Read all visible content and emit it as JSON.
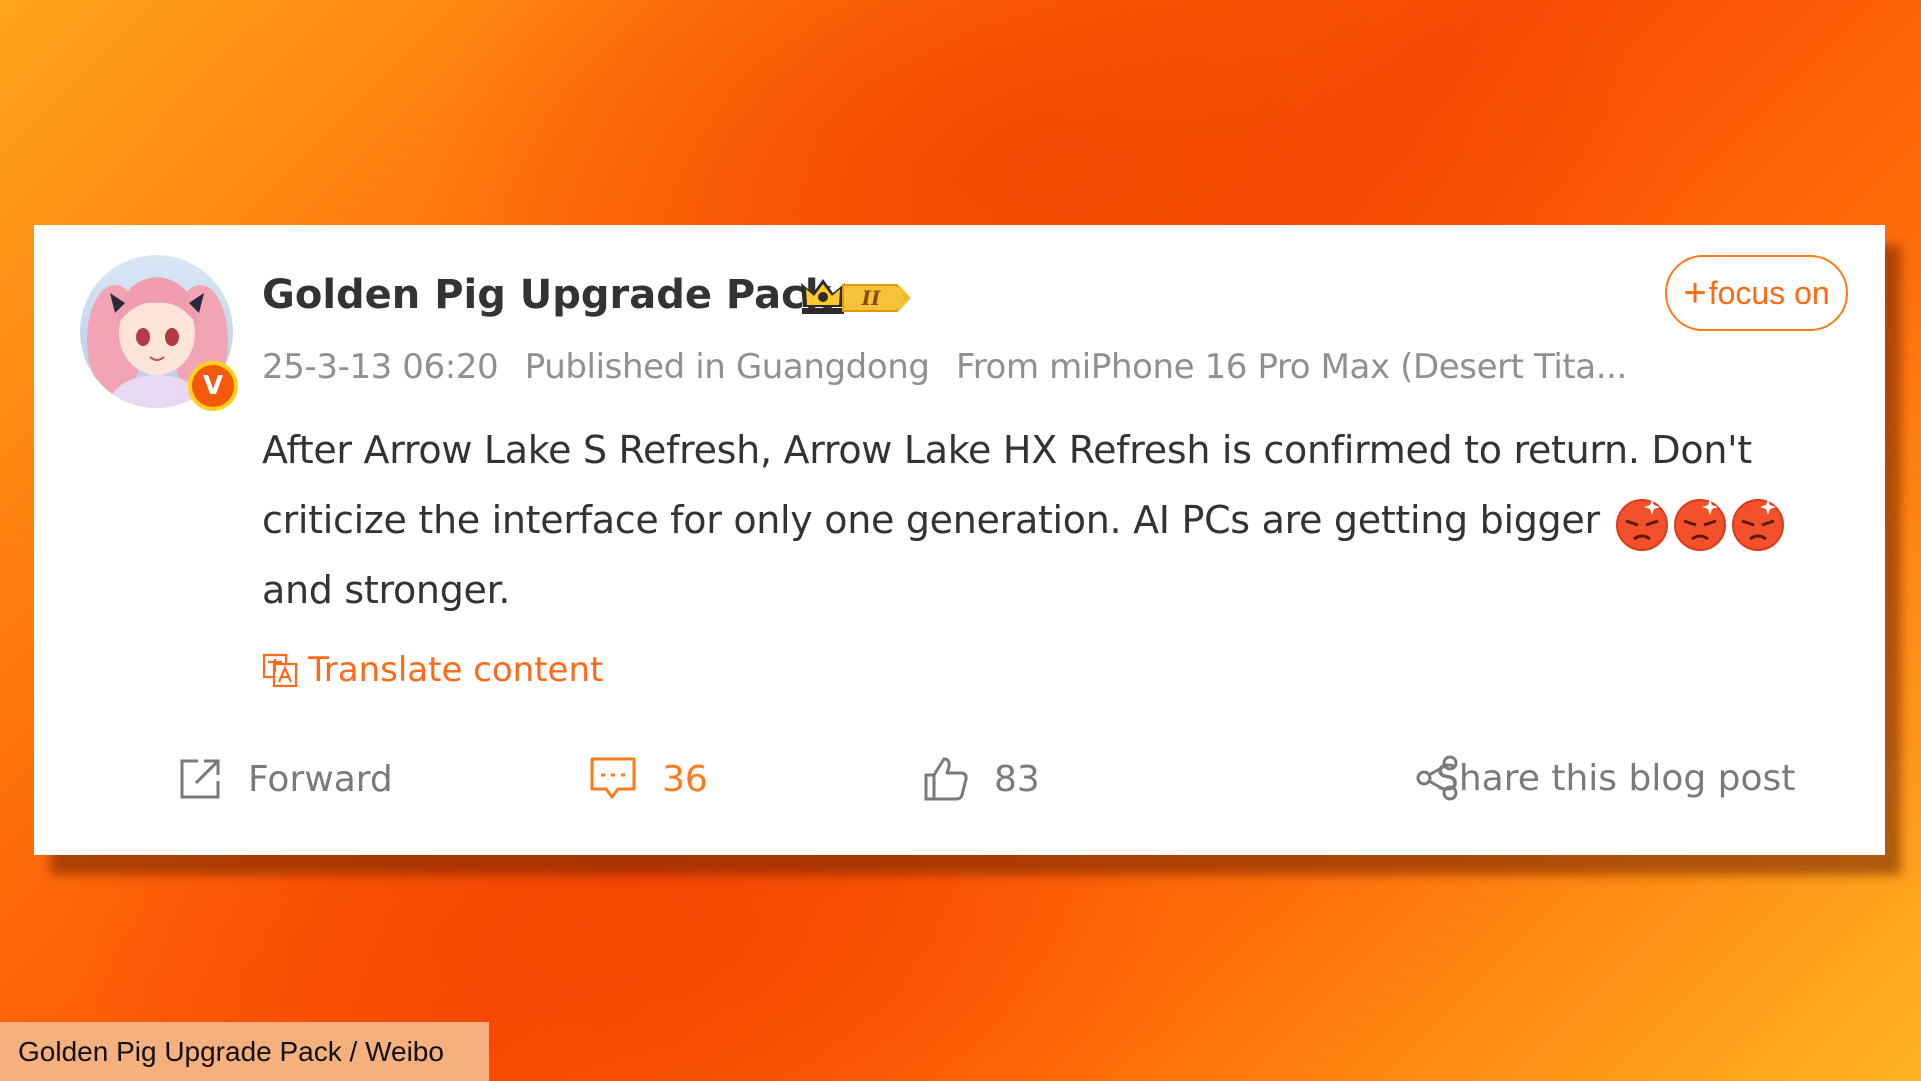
{
  "post": {
    "username": "Golden Pig Upgrade Pack",
    "verified_badge": "V",
    "member_badge": "II",
    "follow": {
      "plus": "+",
      "label": "focus on"
    },
    "meta": {
      "timestamp": "25-3-13 06:20",
      "location": "Published in Guangdong",
      "device": "From miPhone 16 Pro Max (Desert Tita..."
    },
    "content": {
      "text": "After Arrow Lake S Refresh, Arrow Lake HX Refresh is confirmed to return. Don't criticize the interface for only one generation. AI PCs are getting bigger",
      "text_end": "and stronger.",
      "emojis": [
        "angry-emoji",
        "angry-emoji",
        "angry-emoji"
      ]
    },
    "translate_label": "Translate content",
    "actions": {
      "forward": "Forward",
      "comments": "36",
      "likes": "83",
      "share": "Share this blog post"
    }
  },
  "caption": "Golden Pig Upgrade Pack / Weibo",
  "colors": {
    "accent": "#ff6a1a",
    "text": "#333333",
    "muted": "#909090"
  }
}
